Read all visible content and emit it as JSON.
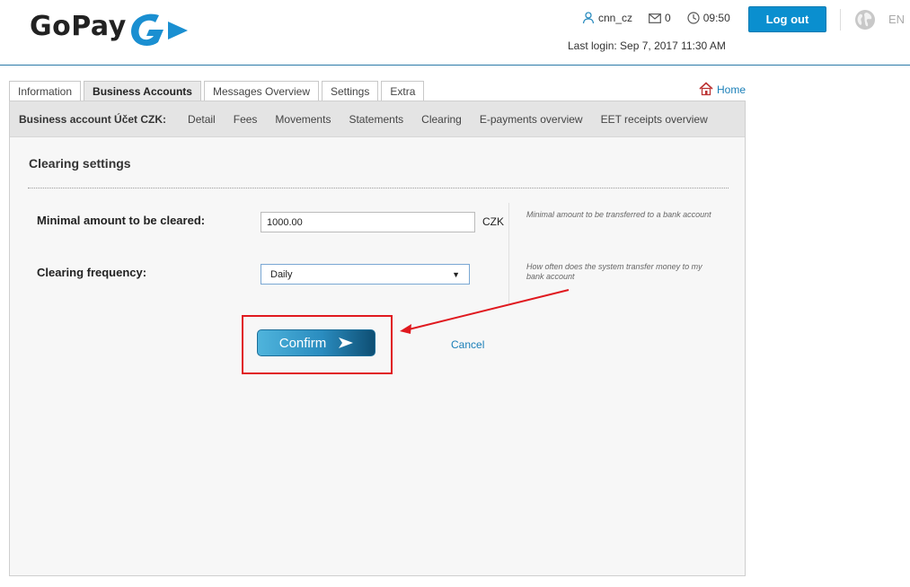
{
  "header": {
    "logo_text": "GoPay",
    "username": "cnn_cz",
    "messages_count": "0",
    "time": "09:50",
    "last_login": "Last login: Sep 7, 2017 11:30 AM",
    "logout_label": "Log out",
    "language": "EN",
    "brand_color": "#0a8fcf"
  },
  "tabs": [
    {
      "label": "Information",
      "active": false
    },
    {
      "label": "Business Accounts",
      "active": true
    },
    {
      "label": "Messages Overview",
      "active": false
    },
    {
      "label": "Settings",
      "active": false
    },
    {
      "label": "Extra",
      "active": false
    }
  ],
  "home_label": "Home",
  "subnav": {
    "account_label": "Business account Účet CZK:",
    "links": [
      "Detail",
      "Fees",
      "Movements",
      "Statements",
      "Clearing",
      "E-payments overview",
      "EET receipts overview"
    ]
  },
  "form": {
    "title": "Clearing settings",
    "min_amount_label": "Minimal amount to be cleared:",
    "min_amount_value": "1000.00",
    "min_amount_unit": "CZK",
    "min_amount_help": "Minimal amount to be transferred to a bank account",
    "frequency_label": "Clearing frequency:",
    "frequency_value": "Daily",
    "frequency_help": "How often does the system transfer money to my bank account",
    "confirm_label": "Confirm",
    "cancel_label": "Cancel"
  },
  "annotation": {
    "highlight_color": "#e0191f"
  }
}
